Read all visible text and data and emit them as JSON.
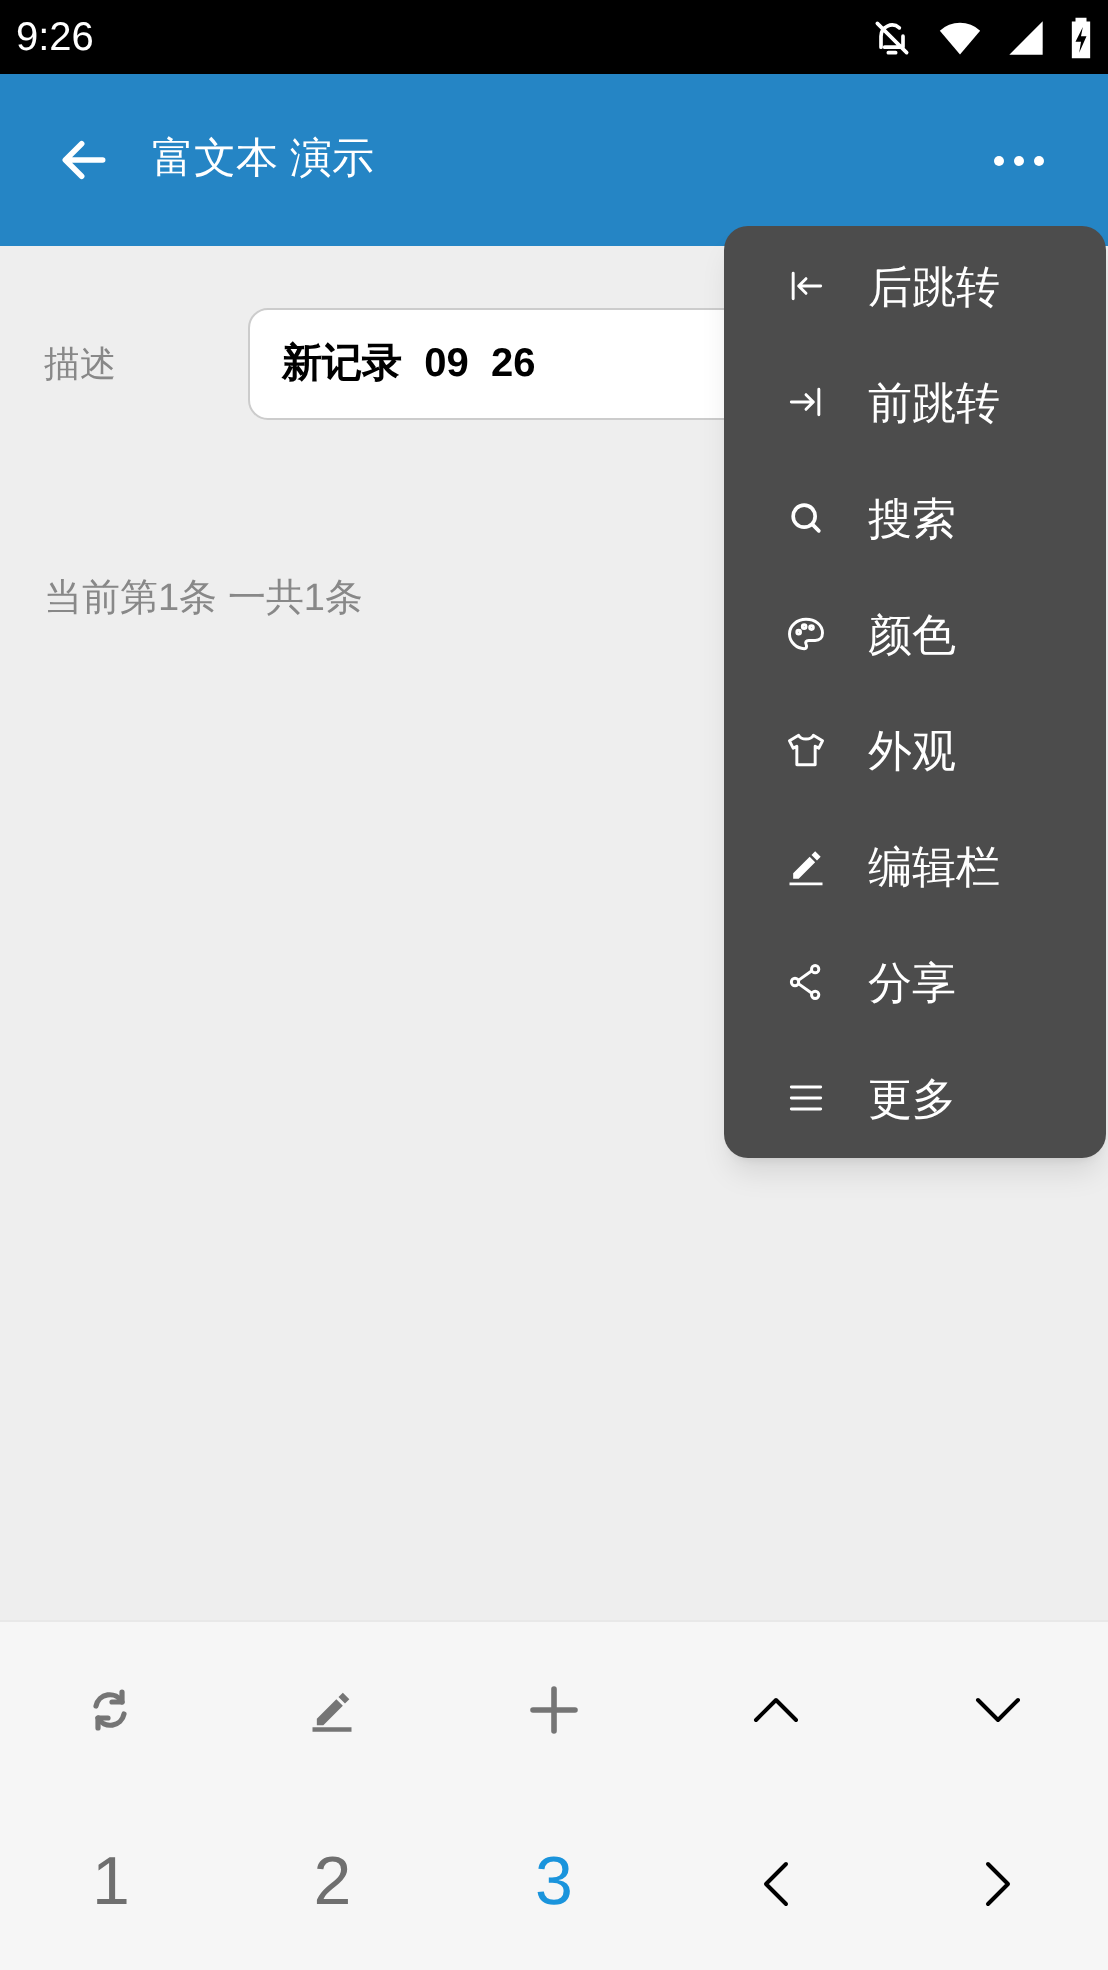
{
  "status_bar": {
    "time": "9:26"
  },
  "app_bar": {
    "title": "富文本 演示"
  },
  "form": {
    "label": "描述",
    "value": "新记录  09  26"
  },
  "record_info": "当前第1条 一共1条",
  "menu": [
    {
      "kind": "jump-back",
      "label": "后跳转"
    },
    {
      "kind": "jump-forward",
      "label": "前跳转"
    },
    {
      "kind": "search",
      "label": "搜索"
    },
    {
      "kind": "palette",
      "label": "颜色"
    },
    {
      "kind": "shirt",
      "label": "外观"
    },
    {
      "kind": "edit",
      "label": "编辑栏"
    },
    {
      "kind": "share",
      "label": "分享"
    },
    {
      "kind": "more",
      "label": "更多"
    }
  ],
  "toolbar": [
    {
      "kind": "refresh"
    },
    {
      "kind": "edit"
    },
    {
      "kind": "add"
    },
    {
      "kind": "up"
    },
    {
      "kind": "down"
    }
  ],
  "pages": [
    {
      "label": "1",
      "selected": false
    },
    {
      "label": "2",
      "selected": false
    },
    {
      "label": "3",
      "selected": true
    }
  ],
  "pager_nav": [
    {
      "kind": "prev"
    },
    {
      "kind": "next"
    }
  ]
}
